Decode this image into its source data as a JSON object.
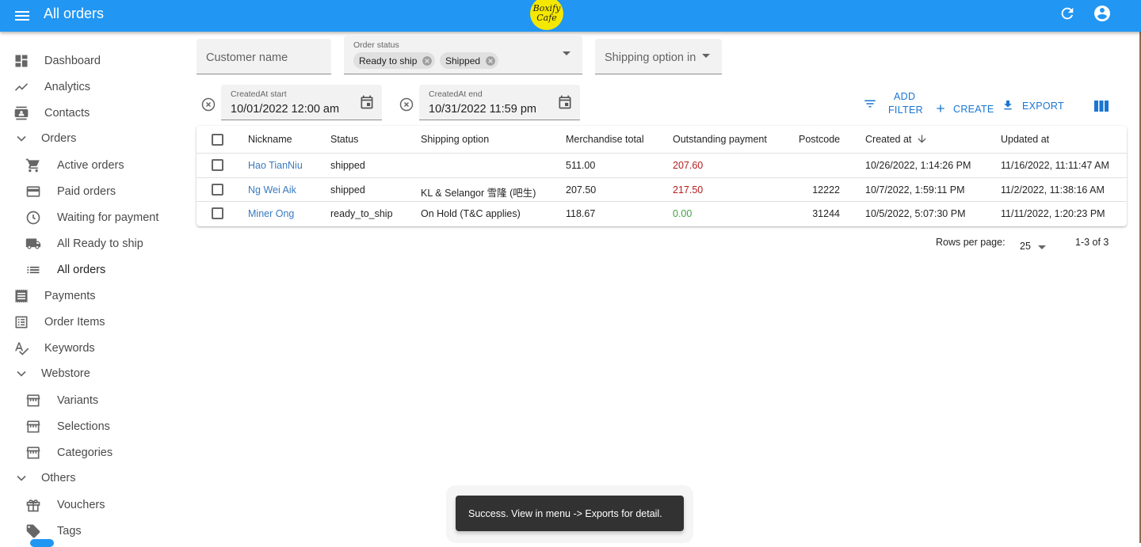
{
  "appbar": {
    "title": "All orders",
    "logo_line1": "Boxify",
    "logo_line2": "Cafe",
    "brand_color": "#2196f3"
  },
  "sidebar": {
    "items": [
      {
        "label": "Dashboard",
        "icon": "dashboard-icon"
      },
      {
        "label": "Analytics",
        "icon": "analytics-icon"
      },
      {
        "label": "Contacts",
        "icon": "contacts-icon"
      },
      {
        "label": "Orders",
        "icon": "chevron-down-icon"
      },
      {
        "label": "Active orders",
        "icon": "cart-icon"
      },
      {
        "label": "Paid orders",
        "icon": "credit-card-icon"
      },
      {
        "label": "Waiting for payment",
        "icon": "clock-icon"
      },
      {
        "label": "All Ready to ship",
        "icon": "truck-icon"
      },
      {
        "label": "All orders",
        "icon": "list-icon"
      },
      {
        "label": "Payments",
        "icon": "receipt-icon"
      },
      {
        "label": "Order Items",
        "icon": "list-alt-icon"
      },
      {
        "label": "Keywords",
        "icon": "spellcheck-icon"
      },
      {
        "label": "Webstore",
        "icon": "chevron-down-icon"
      },
      {
        "label": "Variants",
        "icon": "store-icon"
      },
      {
        "label": "Selections",
        "icon": "store-icon"
      },
      {
        "label": "Categories",
        "icon": "store-icon"
      },
      {
        "label": "Others",
        "icon": "chevron-down-icon"
      },
      {
        "label": "Vouchers",
        "icon": "gift-icon"
      },
      {
        "label": "Tags",
        "icon": "tag-icon"
      }
    ]
  },
  "filters": {
    "customer_name_placeholder": "Customer name",
    "order_status_label": "Order status",
    "order_status_chips": [
      "Ready to ship",
      "Shipped"
    ],
    "shipping_option_placeholder": "Shipping option in",
    "created_start_label": "CreatedAt start",
    "created_start_value": "10/01/2022 12:00 am",
    "created_end_label": "CreatedAt end",
    "created_end_value": "10/31/2022 11:59 pm"
  },
  "toolbar": {
    "add_filter_line1": "ADD",
    "add_filter_line2": "FILTER",
    "create": "CREATE",
    "export": "EXPORT"
  },
  "table": {
    "headers": [
      "Nickname",
      "Status",
      "Shipping option",
      "Merchandise total",
      "Outstanding payment",
      "Postcode",
      "Created at",
      "Updated at"
    ],
    "rows": [
      {
        "nickname": "Hao TianNiu",
        "status": "shipped",
        "shipping": "",
        "merch": "511.00",
        "outstanding": "207.60",
        "postcode": "",
        "created": "10/26/2022, 1:14:26 PM",
        "updated": "11/16/2022, 11:11:47 AM"
      },
      {
        "nickname": "Ng Wei Aik",
        "status": "shipped",
        "shipping": "KL & Selangor 雪隆 (吧生)",
        "merch": "207.50",
        "outstanding": "217.50",
        "postcode": "12222",
        "created": "10/7/2022, 1:59:11 PM",
        "updated": "11/2/2022, 11:38:16 AM"
      },
      {
        "nickname": "Miner Ong",
        "status": "ready_to_ship",
        "shipping": "On Hold (T&C applies)",
        "merch": "118.67",
        "outstanding": "0.00",
        "postcode": "31244",
        "created": "10/5/2022, 5:07:30 PM",
        "updated": "11/11/2022, 1:20:23 PM"
      }
    ]
  },
  "pagination": {
    "rows_per_page_label": "Rows per page:",
    "rows_per_page": "25",
    "range": "1-3 of 3"
  },
  "toast": {
    "message": "Success. View in menu -> Exports for detail."
  }
}
